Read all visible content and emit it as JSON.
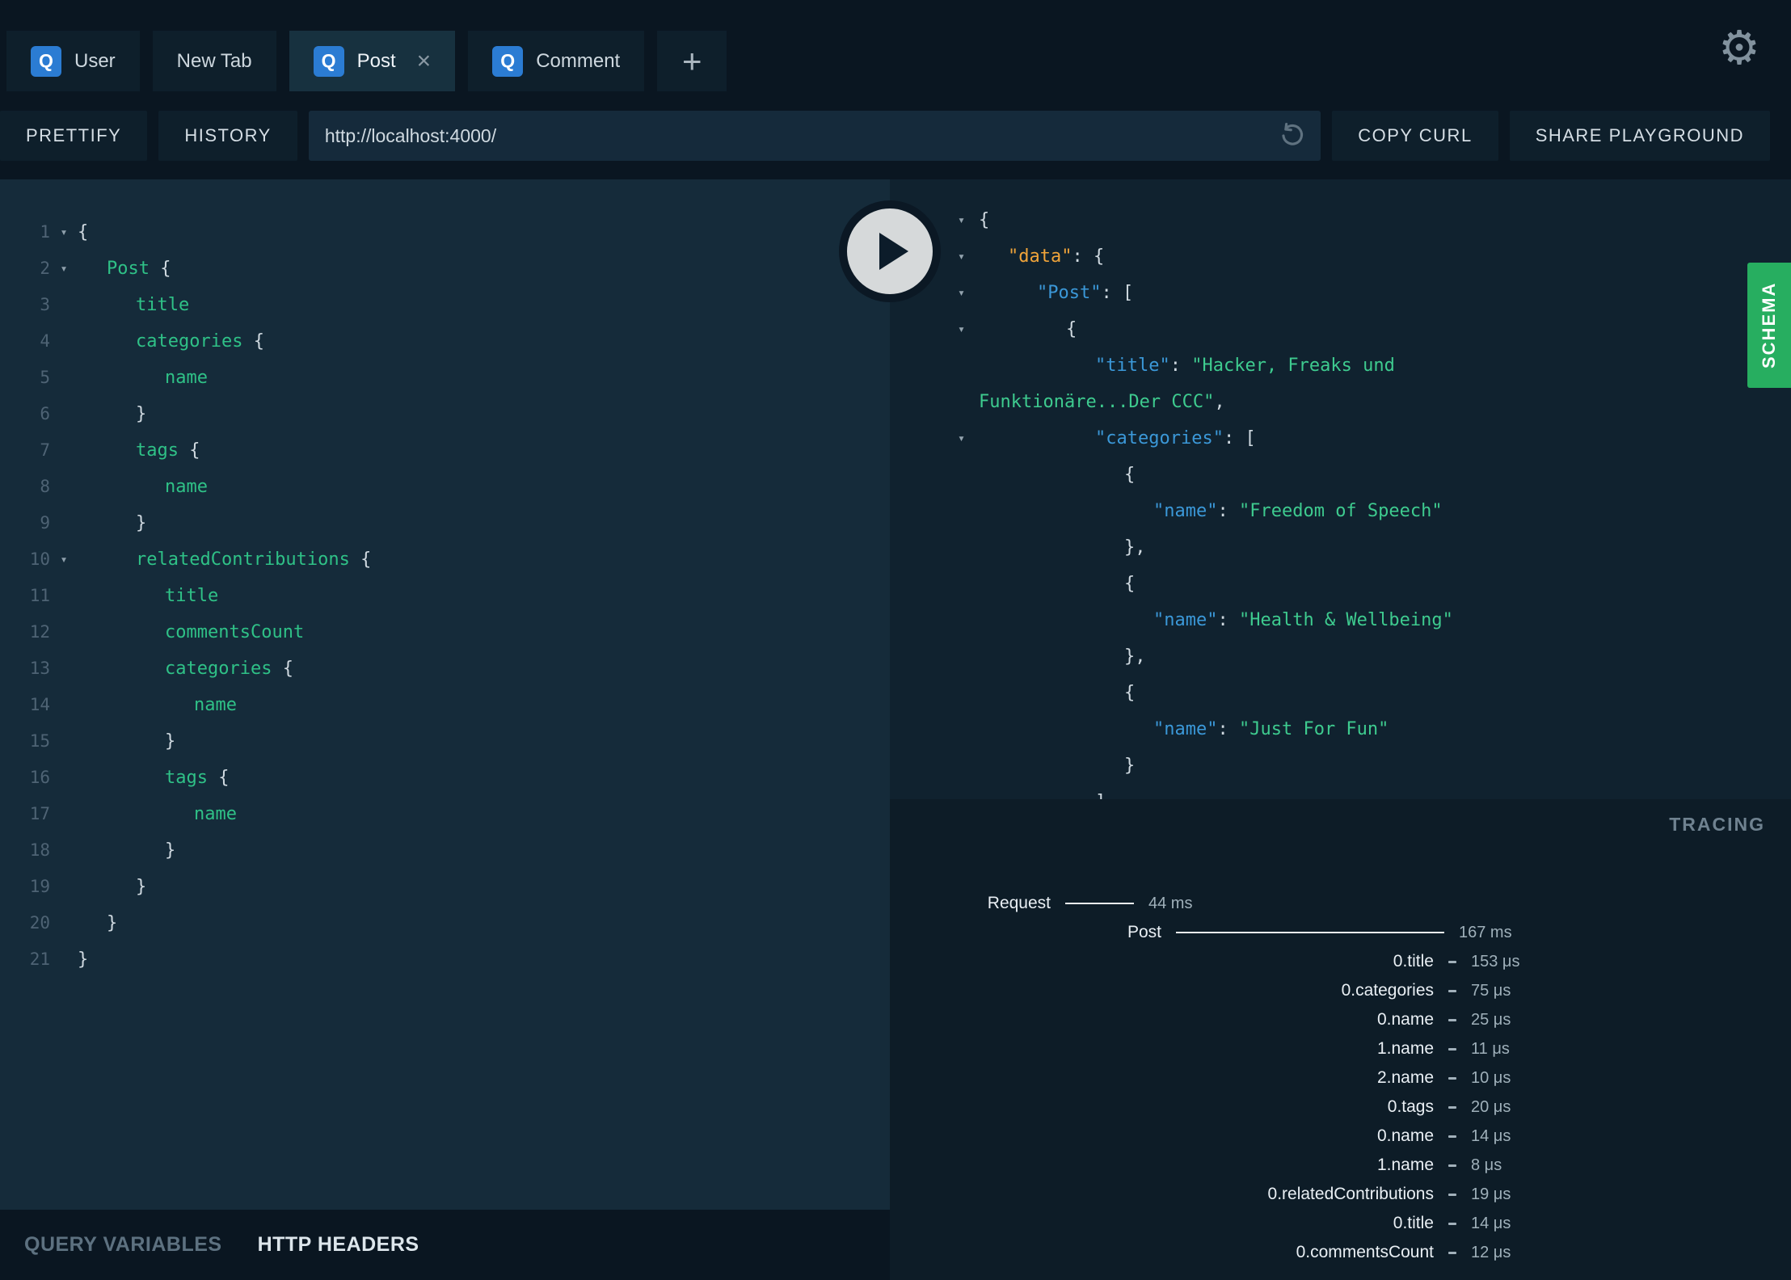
{
  "window": {
    "tabs": [
      {
        "label": "User"
      },
      {
        "label": "New Tab"
      },
      {
        "label": "Post"
      },
      {
        "label": "Comment"
      }
    ],
    "tab_icon_letter": "Q",
    "new_tab_label": "+",
    "close_label": "×"
  },
  "icons": {
    "gear": "⚙",
    "fold": "▾",
    "play": "right-triangle",
    "reload": "circular-arrow"
  },
  "toolbar": {
    "prettify": "PRETTIFY",
    "history": "HISTORY",
    "url": "http://localhost:4000/",
    "copy_curl": "COPY CURL",
    "share": "SHARE PLAYGROUND"
  },
  "editor": {
    "lines": [
      {
        "num": "1",
        "fold": "▾",
        "indent": 0,
        "segments": [
          {
            "text": "{",
            "type": "punc"
          }
        ]
      },
      {
        "num": "2",
        "fold": "▾",
        "indent": 1,
        "segments": [
          {
            "text": "Post ",
            "type": "field"
          },
          {
            "text": "{",
            "type": "punc"
          }
        ]
      },
      {
        "num": "3",
        "fold": "",
        "indent": 2,
        "segments": [
          {
            "text": "title",
            "type": "field"
          }
        ]
      },
      {
        "num": "4",
        "fold": "",
        "indent": 2,
        "segments": [
          {
            "text": "categories ",
            "type": "field"
          },
          {
            "text": "{",
            "type": "punc"
          }
        ]
      },
      {
        "num": "5",
        "fold": "",
        "indent": 3,
        "segments": [
          {
            "text": "name",
            "type": "field"
          }
        ]
      },
      {
        "num": "6",
        "fold": "",
        "indent": 2,
        "segments": [
          {
            "text": "}",
            "type": "punc"
          }
        ]
      },
      {
        "num": "7",
        "fold": "",
        "indent": 2,
        "segments": [
          {
            "text": "tags ",
            "type": "field"
          },
          {
            "text": "{",
            "type": "punc"
          }
        ]
      },
      {
        "num": "8",
        "fold": "",
        "indent": 3,
        "segments": [
          {
            "text": "name",
            "type": "field"
          }
        ]
      },
      {
        "num": "9",
        "fold": "",
        "indent": 2,
        "segments": [
          {
            "text": "}",
            "type": "punc"
          }
        ]
      },
      {
        "num": "10",
        "fold": "▾",
        "indent": 2,
        "segments": [
          {
            "text": "relatedContributions ",
            "type": "field"
          },
          {
            "text": "{",
            "type": "punc"
          }
        ]
      },
      {
        "num": "11",
        "fold": "",
        "indent": 3,
        "segments": [
          {
            "text": "title",
            "type": "field"
          }
        ]
      },
      {
        "num": "12",
        "fold": "",
        "indent": 3,
        "segments": [
          {
            "text": "commentsCount",
            "type": "field"
          }
        ]
      },
      {
        "num": "13",
        "fold": "",
        "indent": 3,
        "segments": [
          {
            "text": "categories ",
            "type": "field"
          },
          {
            "text": "{",
            "type": "punc"
          }
        ]
      },
      {
        "num": "14",
        "fold": "",
        "indent": 4,
        "segments": [
          {
            "text": "name",
            "type": "field"
          }
        ]
      },
      {
        "num": "15",
        "fold": "",
        "indent": 3,
        "segments": [
          {
            "text": "}",
            "type": "punc"
          }
        ]
      },
      {
        "num": "16",
        "fold": "",
        "indent": 3,
        "segments": [
          {
            "text": "tags ",
            "type": "field"
          },
          {
            "text": "{",
            "type": "punc"
          }
        ]
      },
      {
        "num": "17",
        "fold": "",
        "indent": 4,
        "segments": [
          {
            "text": "name",
            "type": "field"
          }
        ]
      },
      {
        "num": "18",
        "fold": "",
        "indent": 3,
        "segments": [
          {
            "text": "}",
            "type": "punc"
          }
        ]
      },
      {
        "num": "19",
        "fold": "",
        "indent": 2,
        "segments": [
          {
            "text": "}",
            "type": "punc"
          }
        ]
      },
      {
        "num": "20",
        "fold": "",
        "indent": 1,
        "segments": [
          {
            "text": "}",
            "type": "punc"
          }
        ]
      },
      {
        "num": "21",
        "fold": "",
        "indent": 0,
        "segments": [
          {
            "text": "}",
            "type": "punc"
          }
        ]
      }
    ]
  },
  "response": {
    "lines": [
      {
        "fold": "▾",
        "indent": 0,
        "segments": [
          {
            "text": "{",
            "type": "punc"
          }
        ]
      },
      {
        "fold": "▾",
        "indent": 1,
        "segments": [
          {
            "text": "\"data\"",
            "type": "keydata"
          },
          {
            "text": ": {",
            "type": "punc"
          }
        ]
      },
      {
        "fold": "▾",
        "indent": 2,
        "segments": [
          {
            "text": "\"Post\"",
            "type": "key"
          },
          {
            "text": ": [",
            "type": "punc"
          }
        ]
      },
      {
        "fold": "▾",
        "indent": 3,
        "segments": [
          {
            "text": "{",
            "type": "punc"
          }
        ]
      },
      {
        "fold": "",
        "indent": 4,
        "segments": [
          {
            "text": "\"title\"",
            "type": "key"
          },
          {
            "text": ": ",
            "type": "punc"
          },
          {
            "text": "\"Hacker, Freaks und",
            "type": "str"
          }
        ]
      },
      {
        "fold": "",
        "indent": 0,
        "segments": [
          {
            "text": "Funktionäre...Der CCC\"",
            "type": "str"
          },
          {
            "text": ",",
            "type": "punc"
          }
        ]
      },
      {
        "fold": "▾",
        "indent": 4,
        "segments": [
          {
            "text": "\"categories\"",
            "type": "key"
          },
          {
            "text": ": [",
            "type": "punc"
          }
        ]
      },
      {
        "fold": "",
        "indent": 5,
        "segments": [
          {
            "text": "{",
            "type": "punc"
          }
        ]
      },
      {
        "fold": "",
        "indent": 6,
        "segments": [
          {
            "text": "\"name\"",
            "type": "key"
          },
          {
            "text": ": ",
            "type": "punc"
          },
          {
            "text": "\"Freedom of Speech\"",
            "type": "str"
          }
        ]
      },
      {
        "fold": "",
        "indent": 5,
        "segments": [
          {
            "text": "},",
            "type": "punc"
          }
        ]
      },
      {
        "fold": "",
        "indent": 5,
        "segments": [
          {
            "text": "{",
            "type": "punc"
          }
        ]
      },
      {
        "fold": "",
        "indent": 6,
        "segments": [
          {
            "text": "\"name\"",
            "type": "key"
          },
          {
            "text": ": ",
            "type": "punc"
          },
          {
            "text": "\"Health & Wellbeing\"",
            "type": "str"
          }
        ]
      },
      {
        "fold": "",
        "indent": 5,
        "segments": [
          {
            "text": "},",
            "type": "punc"
          }
        ]
      },
      {
        "fold": "",
        "indent": 5,
        "segments": [
          {
            "text": "{",
            "type": "punc"
          }
        ]
      },
      {
        "fold": "",
        "indent": 6,
        "segments": [
          {
            "text": "\"name\"",
            "type": "key"
          },
          {
            "text": ": ",
            "type": "punc"
          },
          {
            "text": "\"Just For Fun\"",
            "type": "str"
          }
        ]
      },
      {
        "fold": "",
        "indent": 5,
        "segments": [
          {
            "text": "}",
            "type": "punc"
          }
        ]
      },
      {
        "fold": "",
        "indent": 4,
        "segments": [
          {
            "text": "]",
            "type": "punc"
          }
        ]
      }
    ]
  },
  "schema": {
    "label": "SCHEMA"
  },
  "tracing": {
    "title": "TRACING",
    "rows": [
      {
        "label": "Request",
        "time": "44 ms",
        "kind": "bar",
        "bar": 85,
        "mr": 675
      },
      {
        "label": "Post",
        "time": "167 ms",
        "kind": "bar",
        "bar": 332,
        "mr": 291
      },
      {
        "label": "0.title",
        "time": "153 μs",
        "kind": "dash",
        "bar": 10,
        "mr": 276
      },
      {
        "label": "0.categories",
        "time": "75 μs",
        "kind": "dash",
        "bar": 10,
        "mr": 276
      },
      {
        "label": "0.name",
        "time": "25 μs",
        "kind": "dash",
        "bar": 10,
        "mr": 276
      },
      {
        "label": "1.name",
        "time": "11 μs",
        "kind": "dash",
        "bar": 10,
        "mr": 276
      },
      {
        "label": "2.name",
        "time": "10 μs",
        "kind": "dash",
        "bar": 10,
        "mr": 276
      },
      {
        "label": "0.tags",
        "time": "20 μs",
        "kind": "dash",
        "bar": 10,
        "mr": 276
      },
      {
        "label": "0.name",
        "time": "14 μs",
        "kind": "dash",
        "bar": 10,
        "mr": 276
      },
      {
        "label": "1.name",
        "time": "8 μs",
        "kind": "dash",
        "bar": 10,
        "mr": 276
      },
      {
        "label": "0.relatedContributions",
        "time": "19 μs",
        "kind": "dash",
        "bar": 10,
        "mr": 276
      },
      {
        "label": "0.title",
        "time": "14 μs",
        "kind": "dash",
        "bar": 10,
        "mr": 276
      },
      {
        "label": "0.commentsCount",
        "time": "12 μs",
        "kind": "dash",
        "bar": 10,
        "mr": 276
      }
    ]
  },
  "footer": {
    "query_variables": "QUERY VARIABLES",
    "http_headers": "HTTP HEADERS"
  },
  "colors": {
    "accent_blue": "#2b7cd3",
    "schema_green": "#27ae60",
    "key_blue": "#3b98d8",
    "data_orange": "#f0a43a",
    "string_green": "#3ecb8f",
    "field_green": "#2fc187"
  }
}
